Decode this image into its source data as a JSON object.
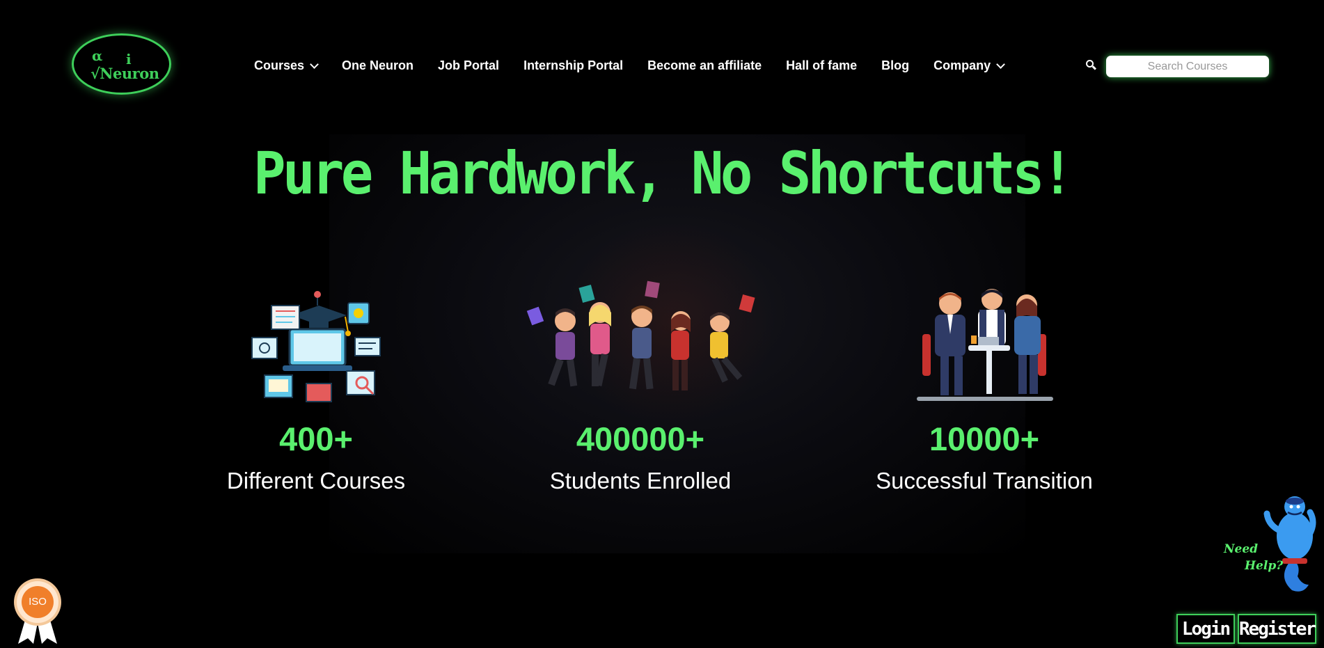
{
  "logo": {
    "alpha": "α",
    "i": "i",
    "word": "√Neuron"
  },
  "nav": {
    "items": [
      {
        "label": "Courses",
        "dropdown": true
      },
      {
        "label": "One Neuron",
        "dropdown": false
      },
      {
        "label": "Job Portal",
        "dropdown": false
      },
      {
        "label": "Internship Portal",
        "dropdown": false
      },
      {
        "label": "Become an affiliate",
        "dropdown": false
      },
      {
        "label": "Hall of fame",
        "dropdown": false
      },
      {
        "label": "Blog",
        "dropdown": false
      },
      {
        "label": "Company",
        "dropdown": true
      }
    ]
  },
  "search": {
    "placeholder": "Search Courses",
    "icon": "search-icon"
  },
  "hero": {
    "headline": "Pure Hardwork, No Shortcuts!"
  },
  "stats": [
    {
      "number": "400+",
      "label": "Different Courses",
      "icon": "courses-illustration"
    },
    {
      "number": "400000+",
      "label": "Students Enrolled",
      "icon": "students-illustration"
    },
    {
      "number": "10000+",
      "label": "Successful Transition",
      "icon": "transition-illustration"
    }
  ],
  "help": {
    "line1": "Need",
    "line2": "Help?"
  },
  "auth": {
    "login": "Login",
    "register": "Register"
  },
  "colors": {
    "accent": "#5af06e",
    "background": "#000000"
  }
}
